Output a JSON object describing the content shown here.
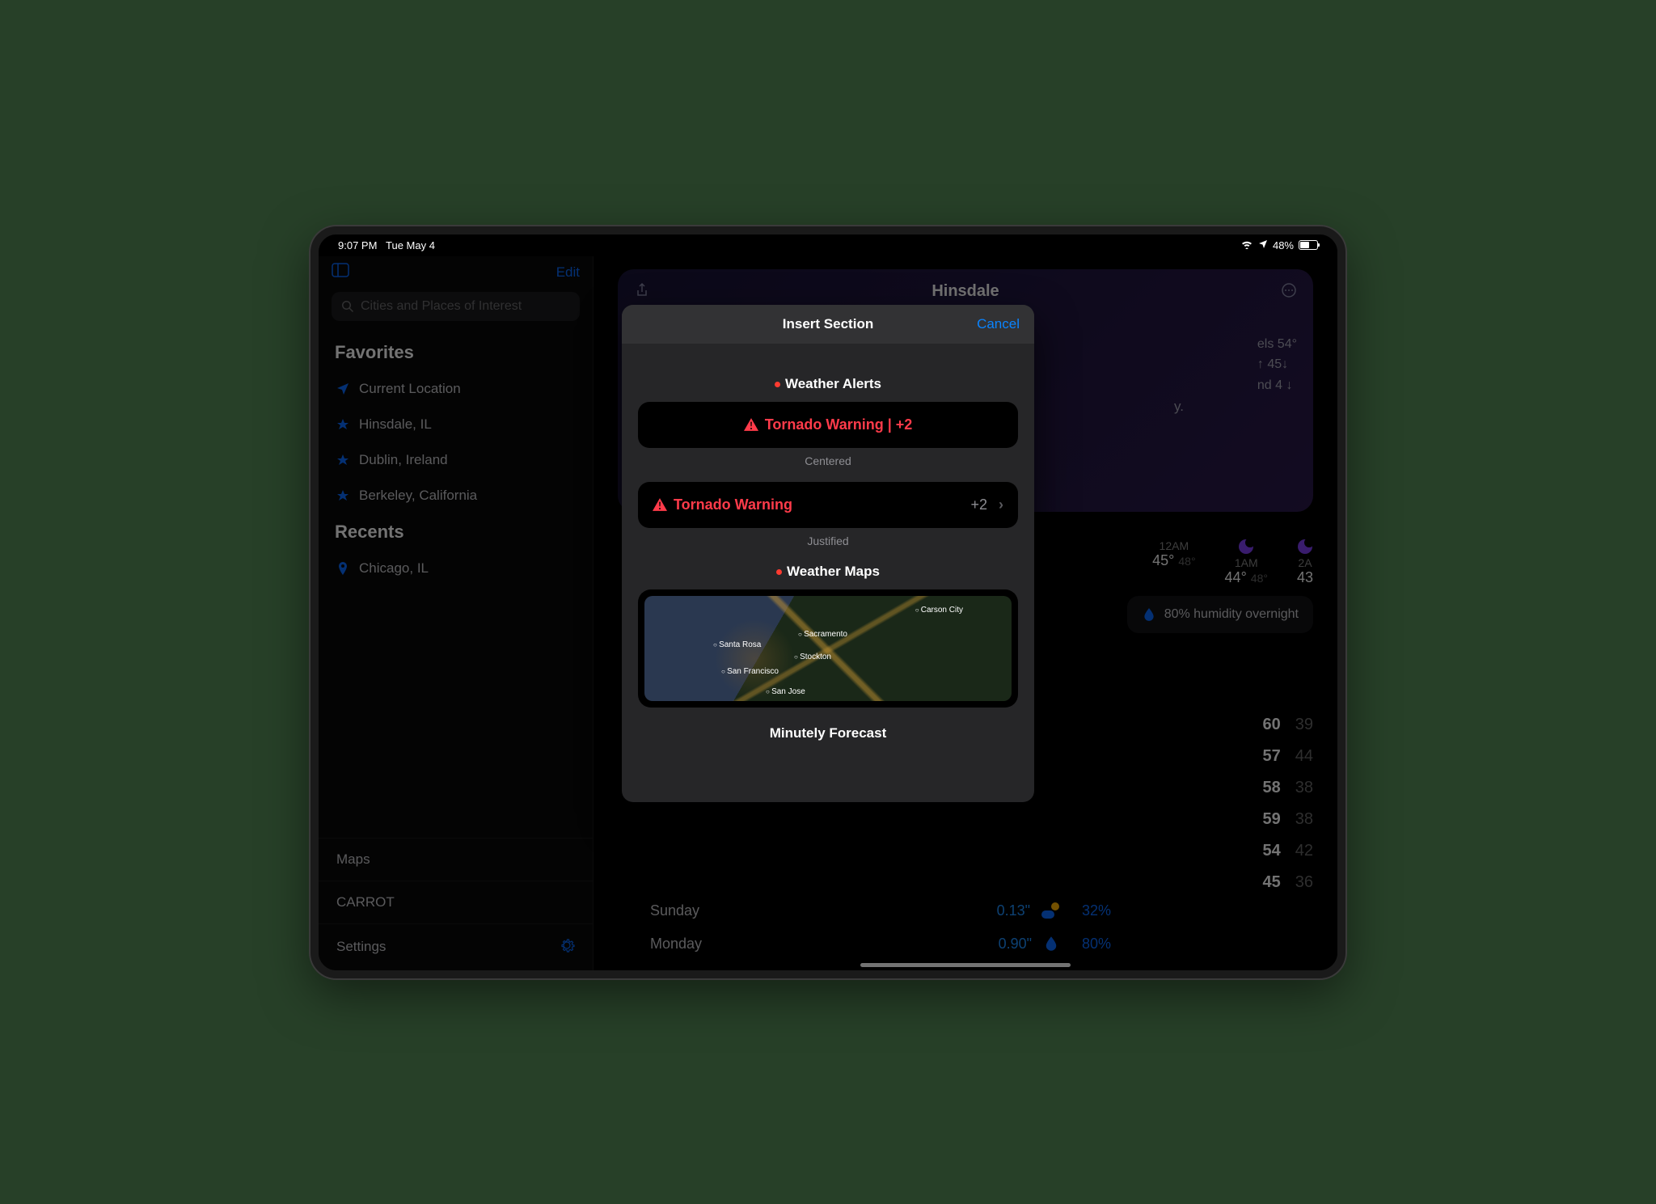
{
  "status_bar": {
    "time": "9:07 PM",
    "date": "Tue May 4",
    "battery": "48%"
  },
  "sidebar": {
    "edit_label": "Edit",
    "search_placeholder": "Cities and Places of Interest",
    "favorites_title": "Favorites",
    "favorites": [
      {
        "label": "Current Location",
        "icon": "location"
      },
      {
        "label": "Hinsdale, IL",
        "icon": "star"
      },
      {
        "label": "Dublin, Ireland",
        "icon": "star"
      },
      {
        "label": "Berkeley, California",
        "icon": "star"
      }
    ],
    "recents_title": "Recents",
    "recents": [
      {
        "label": "Chicago, IL",
        "icon": "pin"
      }
    ],
    "bottom": {
      "maps": "Maps",
      "carrot": "CARROT",
      "settings": "Settings"
    }
  },
  "hero": {
    "location": "Hinsdale",
    "details": [
      "els 54°",
      "↑ 45↓",
      "nd 4 ↓"
    ],
    "sub": "y."
  },
  "hourly": [
    {
      "time": "12AM",
      "hi": "45°",
      "lo": "48°"
    },
    {
      "time": "1AM",
      "hi": "44°",
      "lo": "48°"
    },
    {
      "time": "2A",
      "hi": "43",
      "lo": ""
    }
  ],
  "humidity": "80% humidity overnight",
  "daily": [
    {
      "hi": "60",
      "lo": "39"
    },
    {
      "hi": "57",
      "lo": "44"
    },
    {
      "hi": "58",
      "lo": "38"
    },
    {
      "hi": "59",
      "lo": "38"
    },
    {
      "hi": "54",
      "lo": "42"
    },
    {
      "hi": "45",
      "lo": "36"
    }
  ],
  "forecast_footer": [
    {
      "day": "Sunday",
      "precip": "0.13\"",
      "pct": "32%"
    },
    {
      "day": "Monday",
      "precip": "0.90\"",
      "pct": "80%"
    }
  ],
  "modal": {
    "title": "Insert Section",
    "cancel": "Cancel",
    "weather_alerts": "Weather Alerts",
    "tornado_centered": "Tornado Warning | +2",
    "centered_caption": "Centered",
    "tornado_justified": "Tornado Warning",
    "justified_count": "+2",
    "justified_caption": "Justified",
    "weather_maps": "Weather Maps",
    "map_labels": {
      "carson": "Carson City",
      "sacramento": "Sacramento",
      "santa_rosa": "Santa Rosa",
      "stockton": "Stockton",
      "sf": "San Francisco",
      "sj": "San Jose"
    },
    "minutely": "Minutely Forecast"
  }
}
